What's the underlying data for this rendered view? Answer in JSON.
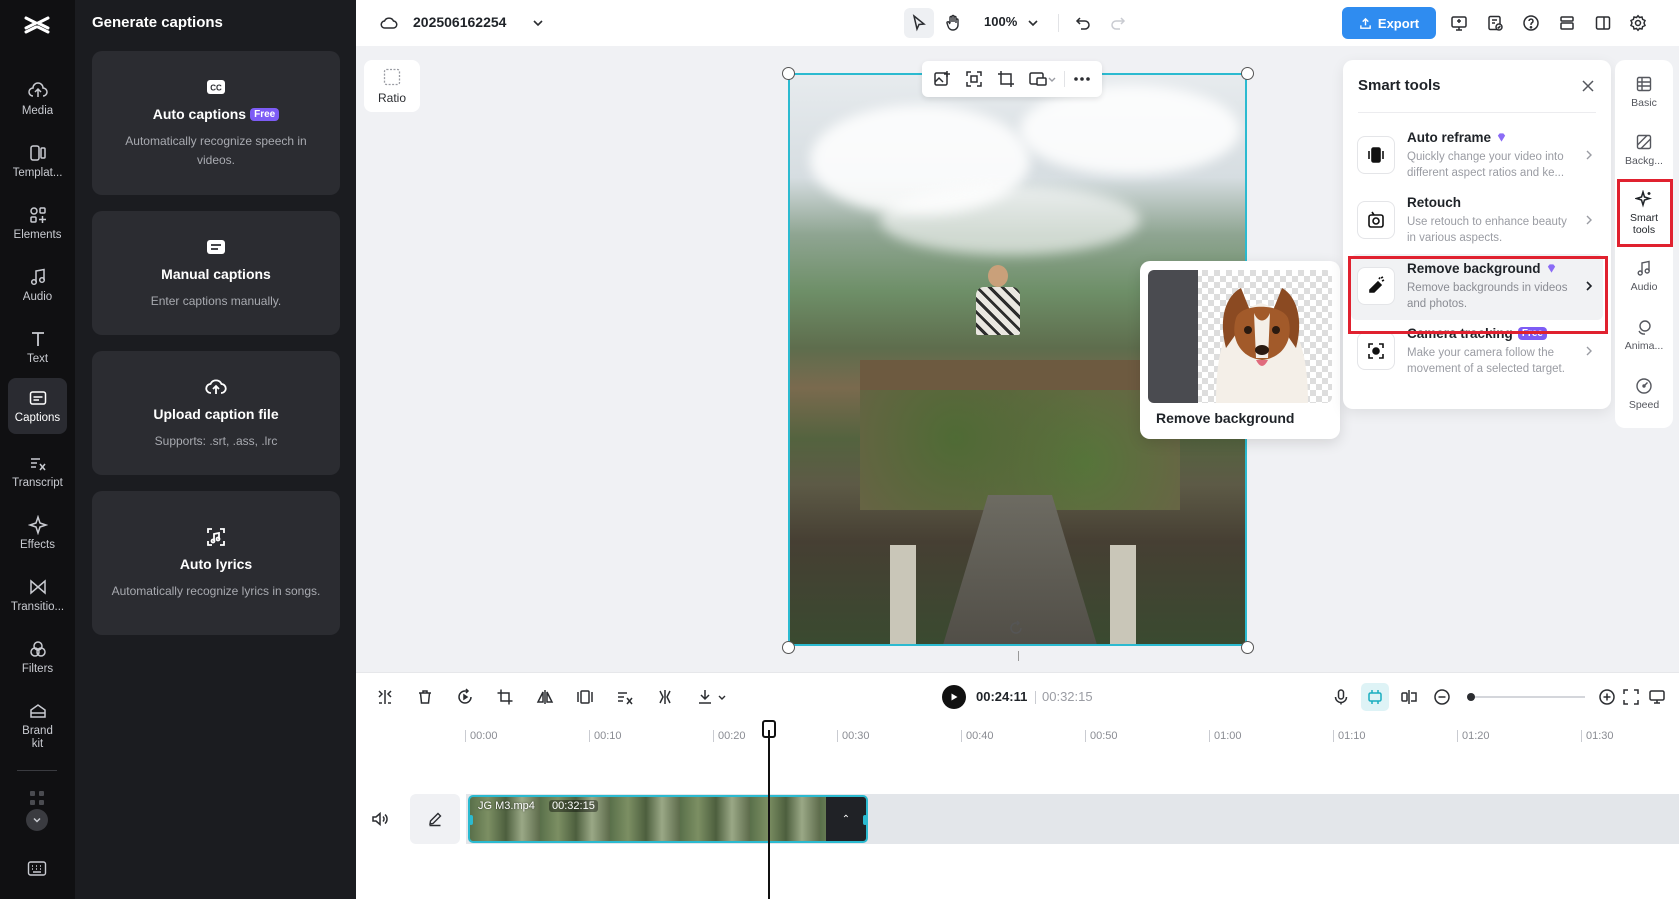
{
  "nav": {
    "items": [
      {
        "label": "Media",
        "icon": "cloud-upload-icon"
      },
      {
        "label": "Templat...",
        "icon": "template-icon"
      },
      {
        "label": "Elements",
        "icon": "elements-icon"
      },
      {
        "label": "Audio",
        "icon": "music-note-icon"
      },
      {
        "label": "Text",
        "icon": "text-icon"
      },
      {
        "label": "Captions",
        "icon": "captions-icon",
        "active": true
      },
      {
        "label": "Transcript",
        "icon": "transcript-icon"
      },
      {
        "label": "Effects",
        "icon": "effects-icon"
      },
      {
        "label": "Transitio...",
        "icon": "transitions-icon"
      },
      {
        "label": "Filters",
        "icon": "filters-icon"
      },
      {
        "label": "Brand kit",
        "icon": "brand-kit-icon"
      }
    ]
  },
  "panel": {
    "title": "Generate captions",
    "cards": [
      {
        "title": "Auto captions",
        "badge": "Free",
        "desc": "Automatically recognize speech in videos.",
        "icon": "cc-icon"
      },
      {
        "title": "Manual captions",
        "desc": "Enter captions manually.",
        "icon": "keyboard-caption-icon"
      },
      {
        "title": "Upload caption file",
        "desc": "Supports: .srt, .ass, .lrc",
        "icon": "cloud-upload-icon"
      },
      {
        "title": "Auto lyrics",
        "desc": "Automatically recognize lyrics in songs.",
        "icon": "lyrics-scan-icon"
      }
    ]
  },
  "topbar": {
    "project_name": "202506162254",
    "zoom": "100%",
    "export_label": "Export"
  },
  "canvas": {
    "ratio_label": "Ratio"
  },
  "preview": {
    "label": "Remove background"
  },
  "smart_tools": {
    "title": "Smart tools",
    "items": [
      {
        "name": "Auto reframe",
        "desc": "Quickly change your video into different aspect ratios and ke...",
        "premium": true,
        "icon": "reframe-icon"
      },
      {
        "name": "Retouch",
        "desc": "Use retouch to enhance beauty in various aspects.",
        "icon": "retouch-icon"
      },
      {
        "name": "Remove background",
        "desc": "Remove backgrounds in videos and photos.",
        "premium": true,
        "icon": "eraser-icon",
        "highlighted": true
      },
      {
        "name": "Camera tracking",
        "badge": "Free",
        "desc": "Make your camera follow the movement of a selected target.",
        "icon": "tracking-icon"
      }
    ]
  },
  "right_rail": {
    "items": [
      {
        "label": "Basic",
        "icon": "basic-icon"
      },
      {
        "label": "Backg...",
        "icon": "background-icon"
      },
      {
        "label": "Smart tools",
        "icon": "sparkle-icon",
        "active": true
      },
      {
        "label": "Audio",
        "icon": "music-note-icon"
      },
      {
        "label": "Anima...",
        "icon": "animation-icon"
      },
      {
        "label": "Speed",
        "icon": "speed-icon"
      }
    ]
  },
  "timeline": {
    "current_time": "00:24:11",
    "total_time": "00:32:15",
    "ticks": [
      "00:00",
      "00:10",
      "00:20",
      "00:30",
      "00:40",
      "00:50",
      "01:00",
      "01:10",
      "01:20",
      "01:30"
    ],
    "clip_name": "JG M3.mp4",
    "clip_duration": "00:32:15",
    "playhead_time": "00:24:11"
  },
  "colors": {
    "accent": "#2bbad0",
    "export": "#2f8cf0",
    "highlight_frame": "#e0212f",
    "free_badge": "#7d5cf5"
  }
}
